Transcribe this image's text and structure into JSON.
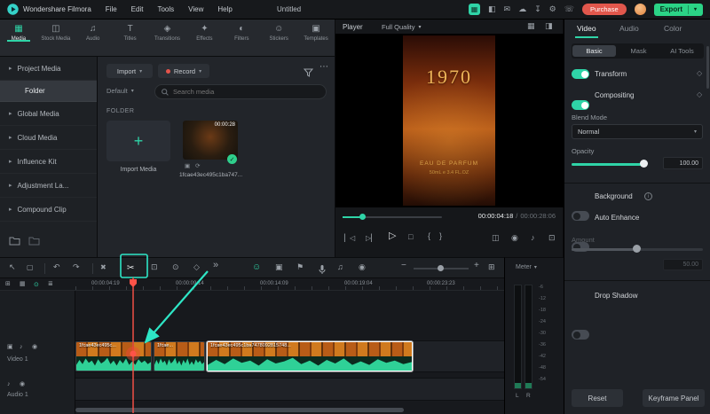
{
  "icons": {
    "caret_down": "▾",
    "chevron_right": "▸",
    "ellipsis": "⋯",
    "plus": "+",
    "check": "✓",
    "pointer": "↖",
    "select": "▢",
    "undo": "↶",
    "redo": "↷",
    "delete": "✖",
    "razor": "✂",
    "crop": "⊡",
    "speed": "⊙",
    "keyframe_diamond": "◇",
    "chevrons": "»",
    "sticker": "☺",
    "screen_record": "▣",
    "marker": "⚑",
    "note": "♫",
    "snapshot": "◉",
    "minus": "−",
    "fit": "⊞",
    "prev_frame": "▏◁",
    "next_frame": "▷▏",
    "play": "▷",
    "stop": "□",
    "mark_in": "{",
    "mark_out": "}",
    "mirror": "◫",
    "camera": "◉",
    "speaker": "♪",
    "expand": "⊡",
    "multi_view": "▦",
    "detach": "◨",
    "apps": "▦",
    "split": "◧",
    "message": "✉",
    "cloud": "☁",
    "download": "↧",
    "gear": "⚙",
    "support": "☏",
    "sync": "⟳",
    "hd": "▣",
    "info": "i",
    "eye": "◉",
    "mute": "♪",
    "video_track": "▣",
    "menu": "≣",
    "add_box": "⊞",
    "snap": "⊙"
  },
  "header": {
    "app_name": "Wondershare Filmora",
    "menus": [
      "File",
      "Edit",
      "Tools",
      "View",
      "Help"
    ],
    "project_title": "Untitled",
    "purchase_label": "Purchase",
    "export_label": "Export"
  },
  "media_tabs": {
    "items": [
      {
        "icon": "▦",
        "label": "Media"
      },
      {
        "icon": "◫",
        "label": "Stock Media"
      },
      {
        "icon": "♫",
        "label": "Audio"
      },
      {
        "icon": "T",
        "label": "Titles"
      },
      {
        "icon": "◈",
        "label": "Transitions"
      },
      {
        "icon": "✦",
        "label": "Effects"
      },
      {
        "icon": "◐",
        "label": "Filters"
      },
      {
        "icon": "☺",
        "label": "Stickers"
      },
      {
        "icon": "▣",
        "label": "Templates"
      }
    ]
  },
  "sidebar": {
    "items": [
      {
        "label": "Project Media"
      },
      {
        "label": "Folder"
      },
      {
        "label": "Global Media"
      },
      {
        "label": "Cloud Media"
      },
      {
        "label": "Influence Kit"
      },
      {
        "label": "Adjustment La..."
      },
      {
        "label": "Compound Clip"
      }
    ]
  },
  "media_browser": {
    "import_button": "Import",
    "record_button": "Record",
    "sort_dropdown": "Default",
    "search_placeholder": "Search media",
    "section_label": "FOLDER",
    "import_tile_label": "Import Media",
    "clip_name": "1fcae43ec495c1ba747...",
    "clip_duration": "00:00:28"
  },
  "player": {
    "panel_label": "Player",
    "quality_dropdown": "Full Quality",
    "preview": {
      "headline": "1970",
      "line2": "EAU DE PARFUM",
      "line3": "50mL e 3.4 FL.OZ"
    },
    "current_time": "00:00:04:18",
    "time_separator": "/",
    "total_time": "00:00:28:06"
  },
  "properties": {
    "tabs": [
      {
        "label": "Video"
      },
      {
        "label": "Audio"
      },
      {
        "label": "Color"
      }
    ],
    "subtabs": [
      {
        "label": "Basic"
      },
      {
        "label": "Mask"
      },
      {
        "label": "AI Tools"
      }
    ],
    "transform_label": "Transform",
    "compositing_label": "Compositing",
    "blend_mode_label": "Blend Mode",
    "blend_mode_value": "Normal",
    "opacity_label": "Opacity",
    "opacity_value": "100.00",
    "background_label": "Background",
    "auto_enhance_label": "Auto Enhance",
    "amount_label": "Amount",
    "amount_value": "50.00",
    "drop_shadow_label": "Drop Shadow",
    "reset_button": "Reset",
    "keyframe_button": "Keyframe Panel"
  },
  "timeline": {
    "ruler_labels": [
      "00:00:04:19",
      "00:00:09:14",
      "00:00:14:09",
      "00:00:19:04",
      "00:00:23:23"
    ],
    "tracks": [
      {
        "label": "Video 1"
      },
      {
        "label": "Audio 1"
      }
    ],
    "clips": [
      {
        "name": "1fcae43ec495c..."
      },
      {
        "name": "1fcae..."
      },
      {
        "name": "1fcae43ec495c1ba7478092815748..."
      }
    ],
    "meter_label": "Meter",
    "meter_scale": [
      "-6",
      "-12",
      "-18",
      "-24",
      "-30",
      "-36",
      "-42",
      "-48",
      "-54"
    ],
    "meter_channels": [
      "L",
      "R"
    ]
  }
}
